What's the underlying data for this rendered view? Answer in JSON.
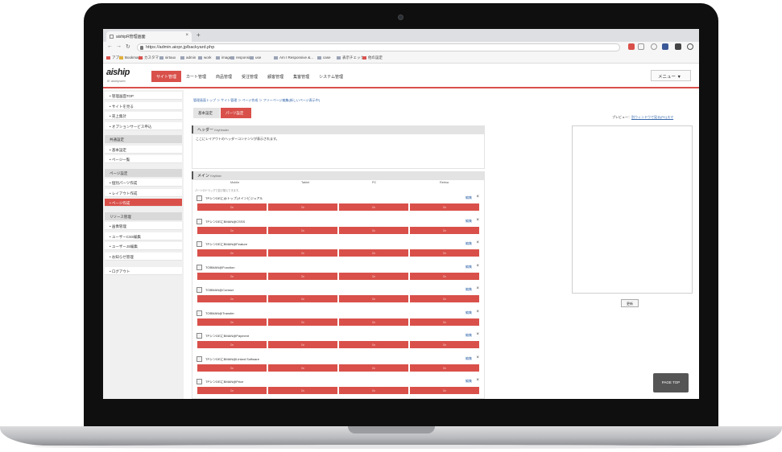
{
  "browser": {
    "tab_title": "aishipR管理画面",
    "url": "https://admin.aiopr.jp/backyard.php",
    "bookmarks": [
      {
        "label": "アプリ",
        "style": "red"
      },
      {
        "label": "Bookmarks",
        "style": "yellow"
      },
      {
        "label": "カスタマ",
        "style": "red"
      },
      {
        "label": "sirtaux",
        "style": ""
      },
      {
        "label": "admin",
        "style": ""
      },
      {
        "label": "work",
        "style": ""
      },
      {
        "label": "images",
        "style": ""
      },
      {
        "label": "responsive",
        "style": ""
      },
      {
        "label": "use",
        "style": ""
      },
      {
        "label": "Am I Responsive &...",
        "style": ""
      },
      {
        "label": "case",
        "style": ""
      },
      {
        "label": "表示チェック",
        "style": ""
      },
      {
        "label": "他の設定",
        "style": "red"
      }
    ]
  },
  "header": {
    "logo": "aiship",
    "logo_sub": "IE aishipweb",
    "nav": [
      "サイト管理",
      "カート管理",
      "商品管理",
      "受注管理",
      "顧客管理",
      "集客管理",
      "システム管理"
    ],
    "menu_label": "メニュー ▼"
  },
  "sidebar": {
    "entries": [
      {
        "label": "• 管理画面TOP",
        "kind": "item"
      },
      {
        "label": "• サイトを見る",
        "kind": "item"
      },
      {
        "label": "• 売上集計",
        "kind": "item"
      },
      {
        "label": "• オプションサービス申込",
        "kind": "item"
      },
      {
        "label": "共通設定",
        "kind": "head"
      },
      {
        "label": "• 基本設定",
        "kind": "item"
      },
      {
        "label": "• ページ一覧",
        "kind": "item"
      },
      {
        "label": "ページ設定",
        "kind": "head"
      },
      {
        "label": "• 個別パーツ作成",
        "kind": "item"
      },
      {
        "label": "• レイアウト作成",
        "kind": "item"
      },
      {
        "label": "• ページ作成",
        "kind": "active"
      },
      {
        "label": "リソース管理",
        "kind": "head"
      },
      {
        "label": "• 画像管理",
        "kind": "item"
      },
      {
        "label": "• ユーザーCSS編集",
        "kind": "item"
      },
      {
        "label": "• ユーザーJS編集",
        "kind": "item"
      },
      {
        "label": "• お知らせ管理",
        "kind": "item"
      },
      {
        "label": "• ログアウト",
        "kind": "item"
      }
    ]
  },
  "main": {
    "breadcrumb": "管理画面トップ ＞ サイト管理 ＞ ページ作成 ＞ フリーページ編集(新しいページ表示中)",
    "tabs": [
      "基本設定",
      "パーツ設定"
    ],
    "header_section": {
      "title": "ヘッダー",
      "sub": "KeyHeader",
      "body": "ここにレイアウトのヘッダーコンテンツが表示されます。"
    },
    "main_section": {
      "title": "メイン",
      "sub": "KeyMain",
      "columns": [
        "Mobile",
        "Tablet",
        "PC",
        "Retina"
      ],
      "note": "パーツのドラッグで並び替えできます。",
      "edit_label": "編集",
      "close_label": "×",
      "on_label": "On",
      "blocks": [
        "TPシンDEに@トップ|メインビジュアル",
        "TPシンDEにBMAN@CSSS",
        "TPシンDEにBMAN@Feature",
        "TOBMAN@Function",
        "TOBMAN@Contact",
        "TOBMAN@Transfer",
        "TPシンDEにBMAN@Payment",
        "TPシンDEにBMAN@Linked Software",
        "TPシンDEにBMAN@Price"
      ]
    }
  },
  "preview": {
    "label": "プレビュー：",
    "link": "別ウィンドウで見る(PC)スマ",
    "update_label": "更新"
  },
  "pagetop": "PAGE TOP"
}
